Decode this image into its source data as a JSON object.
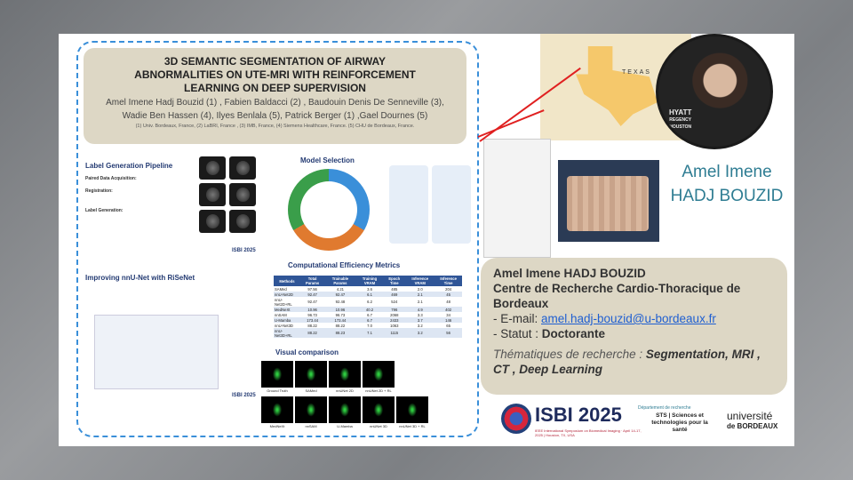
{
  "poster": {
    "title": "3D SEMANTIC SEGMENTATION OF AIRWAY ABNORMALITIES ON UTE-MRI WITH REINFORCEMENT LEARNING ON DEEP SUPERVISION",
    "authors_line1": "Amel Imene Hadj Bouzid (1) , Fabien Baldacci (2) , Baudouin Denis De Senneville (3),",
    "authors_line2": "Wadie Ben Hassen (4), Ilyes Benlala (5), Patrick Berger (1) ,Gael Dournes (5)",
    "affiliations": "(1) Univ. Bordeaux, France, (2) LaBRI, France , (3) IMB, France, (4) Siemens Healthcare, France. (5) CHU de Bordeaux, France.",
    "label_pipeline_title": "Label Generation Pipeline",
    "paired_data": "Paired Data Acquisition:",
    "registration": "Registration:",
    "label_generation": "Label Generation:",
    "nnunet_title": "Improving nnU-Net with RiSeNet",
    "model_selection_title": "Model Selection",
    "efficiency_title": "Computational Efficiency Metrics",
    "visual_title": "Visual comparison",
    "isbi_small": "ISBI 2025",
    "table": {
      "headers": [
        "Methods",
        "Total Params",
        "Trainable Params",
        "Training VRAM",
        "Epoch Time",
        "Inference VRAM",
        "Inference Time"
      ],
      "rows": [
        [
          "SAMed",
          "97.56",
          "4.21",
          "3.6",
          "485",
          "2.0",
          "204"
        ],
        [
          "nnU-Net2D",
          "92.47",
          "92.47",
          "6.1",
          "469",
          "2.1",
          "45"
        ],
        [
          "nnU-Net2D+RL",
          "92.47",
          "92.48",
          "6.2",
          "524",
          "2.1",
          "48"
        ],
        [
          "MedNeXt",
          "10.96",
          "10.96",
          "40.2",
          "796",
          "4.9",
          "402"
        ],
        [
          "nnSAM",
          "96.73",
          "96.73",
          "6.7",
          "2068",
          "3.3",
          "34"
        ],
        [
          "U-Mamba",
          "173.44",
          "173.44",
          "6.7",
          "2433",
          "3.7",
          "146"
        ],
        [
          "nnU-Net3D",
          "88.22",
          "88.22",
          "7.0",
          "1063",
          "3.2",
          "65"
        ],
        [
          "nnU-Net3D+RL",
          "88.22",
          "88.23",
          "7.1",
          "1115",
          "3.2",
          "56"
        ]
      ]
    },
    "viz_labels_row1": [
      "Ground Truth",
      "SAMed",
      "nnUNet 2D",
      "nnUNet 2D + RL"
    ],
    "viz_labels_row2": [
      "MedNeXt",
      "nnSAM",
      "U-Mamba",
      "nnUNet 3D",
      "nnUNet 3D + RL"
    ]
  },
  "map": {
    "state_label": "TEXAS"
  },
  "hotel": {
    "line1": "HYATT",
    "line2": "REGENCY",
    "line3": "HOUSTON"
  },
  "presenter": {
    "first_name": "Amel Imene",
    "last_name": "HADJ BOUZID"
  },
  "info": {
    "name": "Amel Imene HADJ BOUZID",
    "lab": "Centre de Recherche Cardio-Thoracique de Bordeaux",
    "email_label": "- E-mail: ",
    "email": "amel.hadj-bouzid@u-bordeaux.fr",
    "status_label": "- Statut : ",
    "status": "Doctorante",
    "themes_label": "Thématiques de recherche : ",
    "themes": "Segmentation, MRI , CT , Deep Learning"
  },
  "logos": {
    "isbi": "ISBI 2025",
    "isbi_sub": "IEEE International Symposium on Biomedical Imaging · April 14-17, 2025 | Houston, TX, USA",
    "dept": "Département de recherche",
    "sts": "STS | Sciences et technologies pour la santé",
    "univ": "université",
    "univ_sub": "de BORDEAUX"
  },
  "colors": {
    "accent_teal": "#2f7d93",
    "title_box": "#ddd7c5",
    "link_blue": "#1f5fd1",
    "navy": "#233a72",
    "dashed_border": "#3a8fd9"
  }
}
